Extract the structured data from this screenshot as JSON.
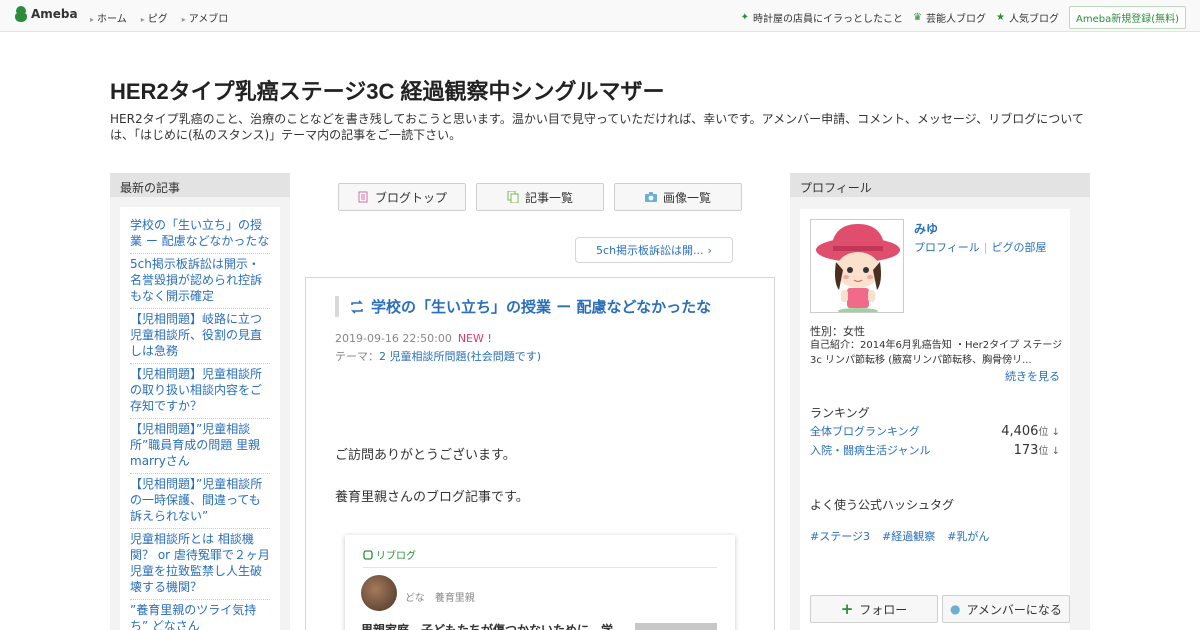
{
  "topbar": {
    "logo": "Ameba",
    "nav": [
      "ホーム",
      "ピグ",
      "アメブロ"
    ],
    "right_links": [
      "時計屋の店員にイラっとしたこと",
      "芸能人ブログ",
      "人気ブログ"
    ],
    "register": "Ameba新規登録(無料)"
  },
  "header": {
    "title": "HER2タイプ乳癌ステージ3C 経過観察中シングルマザー",
    "description": "HER2タイプ乳癌のこと、治療のことなどを書き残しておこうと思います。温かい目で見守っていただければ、幸いです。アメンバー申請、コメント、メッセージ、リブログについては、「はじめに(私のスタンス)」テーマ内の記事をご一読下さい。"
  },
  "recent": {
    "heading": "最新の記事",
    "items": [
      "学校の「生い立ち」の授業 ー 配慮などなかったな",
      "5ch掲示板訴訟は開示・名誉毀損が認められ控訴もなく開示確定",
      "【児相問題】岐路に立つ児童相談所、役割の見直しは急務",
      "【児相問題】児童相談所の取り扱い相談内容をご存知ですか？",
      "【児相問題】”児童相談所”職員育成の問題 里親marryさん",
      "【児相問題】”児童相談所の一時保護、間違っても訴えられない”",
      "児童相談所とは 相談機関？ or 虐待冤罪で２ヶ月児童を拉致監禁し人生破壊する機関？",
      "”養育里親のツライ気持ち” どなさん"
    ]
  },
  "navbuttons": [
    "ブログトップ",
    "記事一覧",
    "画像一覧"
  ],
  "prev_link": "5ch掲示板訴訟は開...",
  "article": {
    "title": "学校の「生い立ち」の授業 ー 配慮などなかったな",
    "date": "2019-09-16 22:50:00",
    "new_badge": "NEW !",
    "theme_label": "テーマ：",
    "theme": "2 児童相談所問題(社会問題です)",
    "body1": "ご訪問ありがとうございます。",
    "body2": "養育里親さんのブログ記事です。",
    "reblog": {
      "label": "リブログ",
      "author": "どな　養育里親",
      "title": "里親家庭　子どもたちが傷つかないために　学"
    }
  },
  "profile": {
    "heading": "プロフィール",
    "name": "みゆ",
    "link_profile": "プロフィール",
    "link_pigg": "ピグの部屋",
    "gender": "性別：女性",
    "intro": "自己紹介：2014年6月乳癌告知 ・Her2タイプ ステージ3c リンパ節転移 (腋窩リンパ節転移、胸骨傍リ...",
    "more": "続きを見る",
    "ranking_heading": "ランキング",
    "rankings": [
      {
        "label": "全体ブログランキング",
        "value": "4,406",
        "unit": "位 ↓"
      },
      {
        "label": "入院・闘病生活ジャンル",
        "value": "173",
        "unit": "位 ↓"
      }
    ],
    "hashtag_heading": "よく使う公式ハッシュタグ",
    "hashtags": [
      "#ステージ3",
      "#経過観察",
      "#乳がん"
    ],
    "btn_follow": "フォロー",
    "btn_amember": "アメンバーになる"
  }
}
